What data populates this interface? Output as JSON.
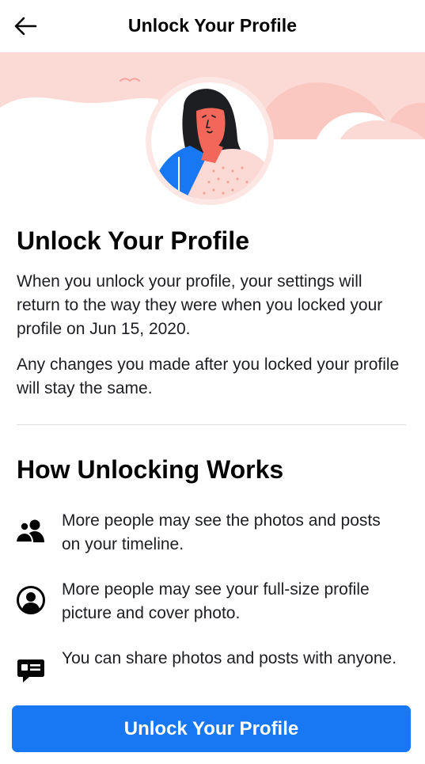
{
  "header": {
    "title": "Unlock Your Profile",
    "back_icon": "arrow-left-icon"
  },
  "hero": {
    "illustration": "woman-avatar-illustration",
    "colors": {
      "band": "#fbd9d4",
      "cloud": "#fbc8c1",
      "skin": "#f3665a",
      "hair": "#1c1e21",
      "shirt_blue": "#1877f2",
      "shirt_pink": "#fbd9d4"
    }
  },
  "main": {
    "heading": "Unlock Your Profile",
    "paragraph1": "When you unlock your profile, your settings will return to the way they were when you locked your profile on Jun 15, 2020.",
    "paragraph2": "Any changes you made after you locked your profile will stay the same."
  },
  "how": {
    "heading": "How Unlocking Works",
    "items": [
      {
        "icon": "people-icon",
        "text": "More people may see the photos and posts on your timeline."
      },
      {
        "icon": "profile-circle-icon",
        "text": "More people may see your full-size profile picture and cover photo."
      },
      {
        "icon": "share-chat-icon",
        "text": "You can share photos and posts with anyone."
      }
    ]
  },
  "footer": {
    "button_label": "Unlock Your Profile",
    "accent": "#1877f2"
  }
}
